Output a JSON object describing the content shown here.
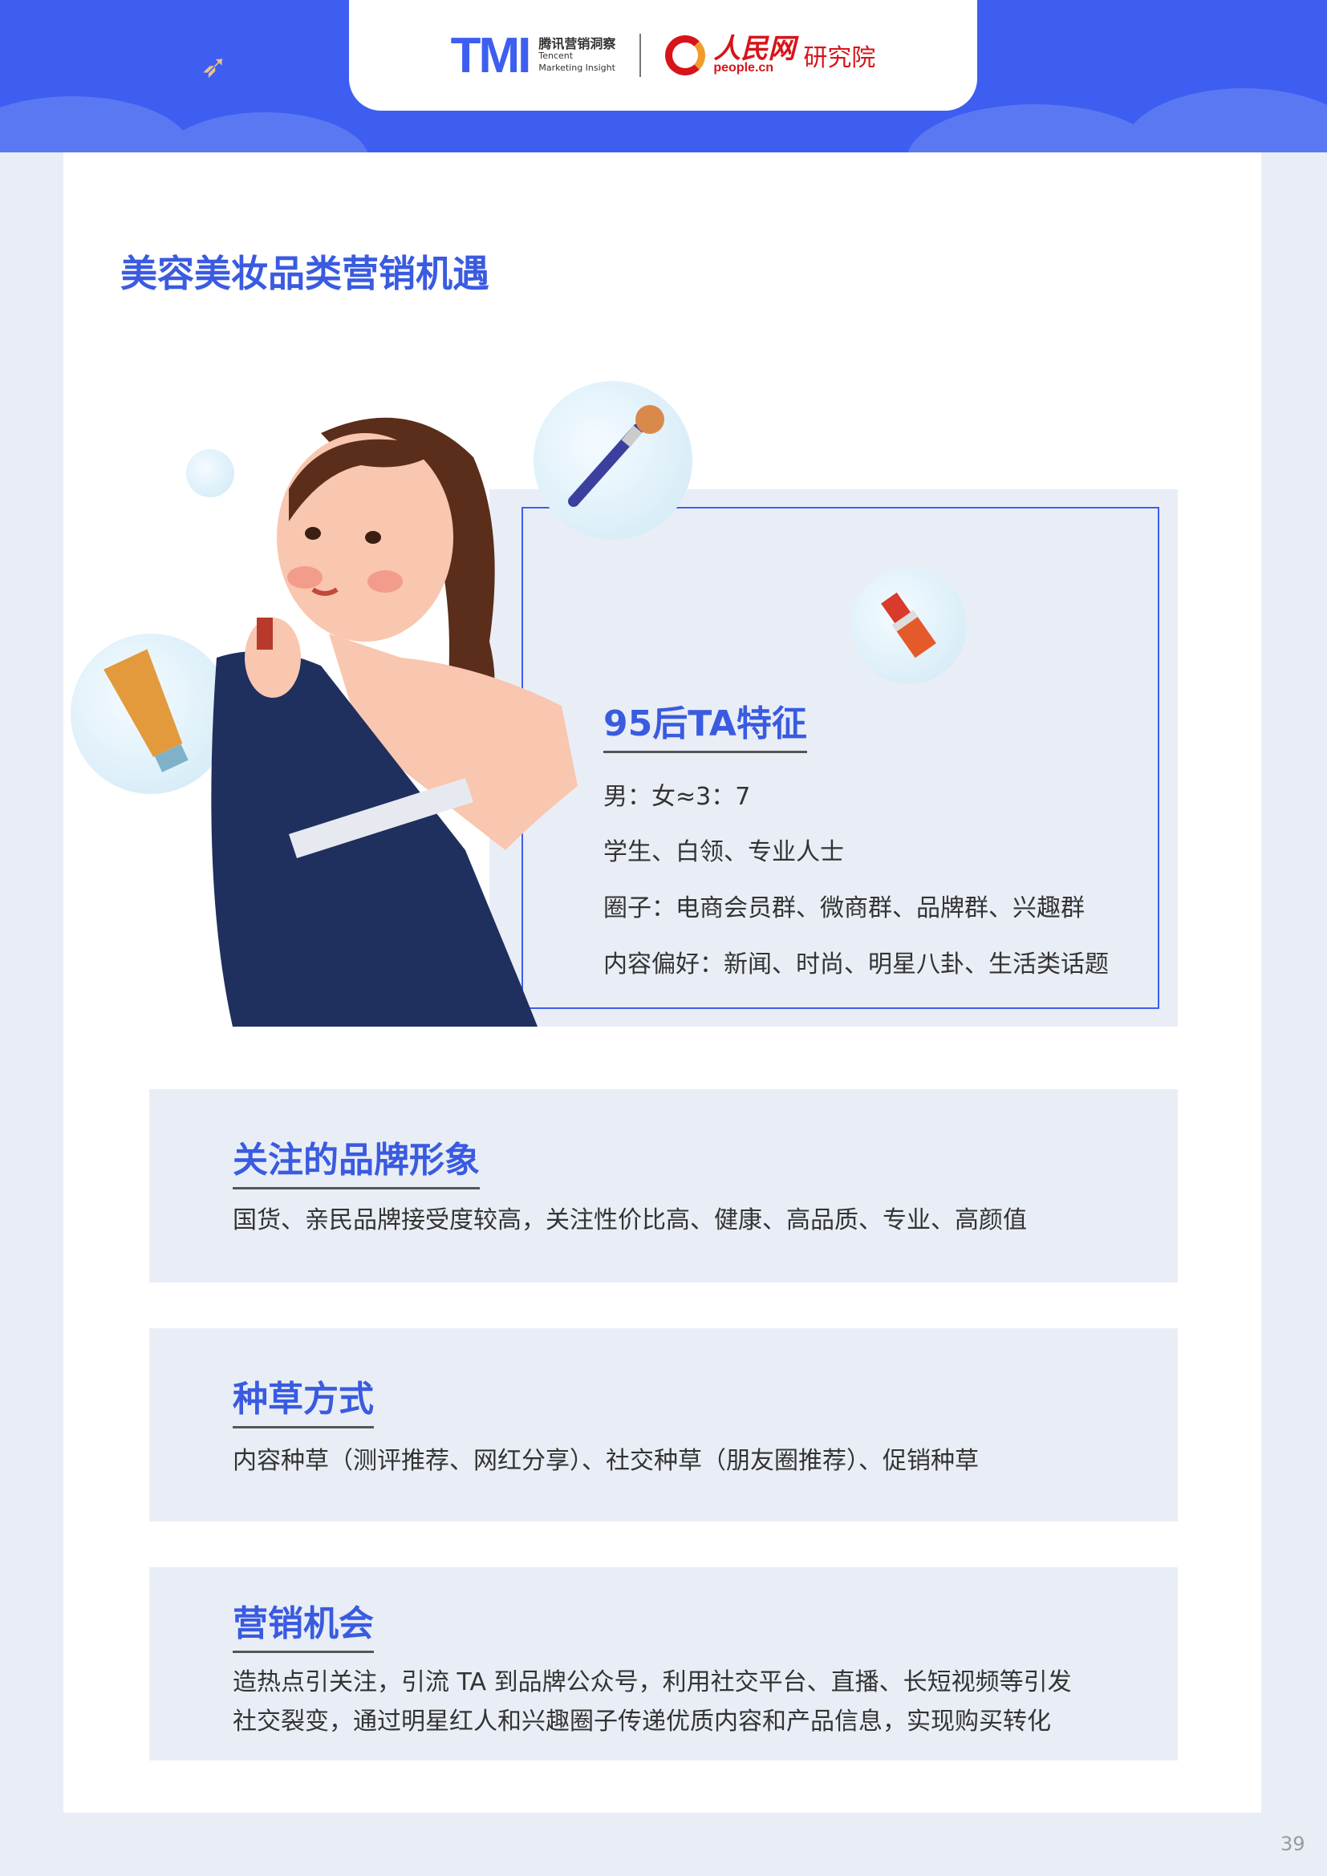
{
  "header": {
    "tmi_logo": "TMI",
    "tmi_cn": "腾讯营销洞察",
    "tmi_en1": "Tencent",
    "tmi_en2": "Marketing Insight",
    "people_logo": "人民网",
    "people_domain": "people.cn",
    "people_institute": "研究院"
  },
  "title": "美容美妆品类营销机遇",
  "ta": {
    "heading": "95后TA特征",
    "lines": [
      "男：女≈3：7",
      "学生、白领、专业人士",
      "圈子：电商会员群、微商群、品牌群、兴趣群",
      "内容偏好：新闻、时尚、明星八卦、生活类话题"
    ]
  },
  "sections": [
    {
      "heading": "关注的品牌形象",
      "lines": [
        "国货、亲民品牌接受度较高，关注性价比高、健康、高品质、专业、高颜值"
      ]
    },
    {
      "heading": "种草方式",
      "lines": [
        "内容种草（测评推荐、网红分享）、社交种草（朋友圈推荐）、促销种草"
      ]
    },
    {
      "heading": "营销机会",
      "lines": [
        "造热点引关注，引流 TA 到品牌公众号，利用社交平台、直播、长短视频等引发",
        "社交裂变，通过明星红人和兴趣圈子传递优质内容和产品信息，实现购买转化"
      ]
    }
  ],
  "page_number": "39",
  "colors": {
    "brand": "#3d5ef0",
    "heading": "#3a5be0",
    "panel": "#e9eef6"
  }
}
